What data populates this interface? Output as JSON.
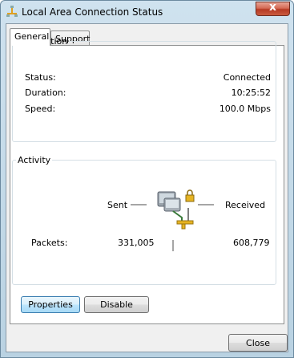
{
  "window": {
    "title": "Local Area Connection Status",
    "close_glyph": "x"
  },
  "tabs": [
    {
      "label": "General"
    },
    {
      "label": "Support"
    }
  ],
  "connection": {
    "title": "Connection",
    "rows": [
      {
        "label": "Status:",
        "value": "Connected"
      },
      {
        "label": "Duration:",
        "value": "10:25:52"
      },
      {
        "label": "Speed:",
        "value": "100.0 Mbps"
      }
    ]
  },
  "activity": {
    "title": "Activity",
    "sent_label": "Sent",
    "received_label": "Received",
    "packets_label": "Packets:",
    "packets_sent": "331,005",
    "packets_received": "608,779",
    "icon": "network-computers-icon"
  },
  "buttons": {
    "properties": "Properties",
    "disable": "Disable",
    "close": "Close"
  },
  "colors": {
    "title_bar": "#cfe2ef",
    "close_red": "#c9452e",
    "default_button": "#bee6fd"
  }
}
